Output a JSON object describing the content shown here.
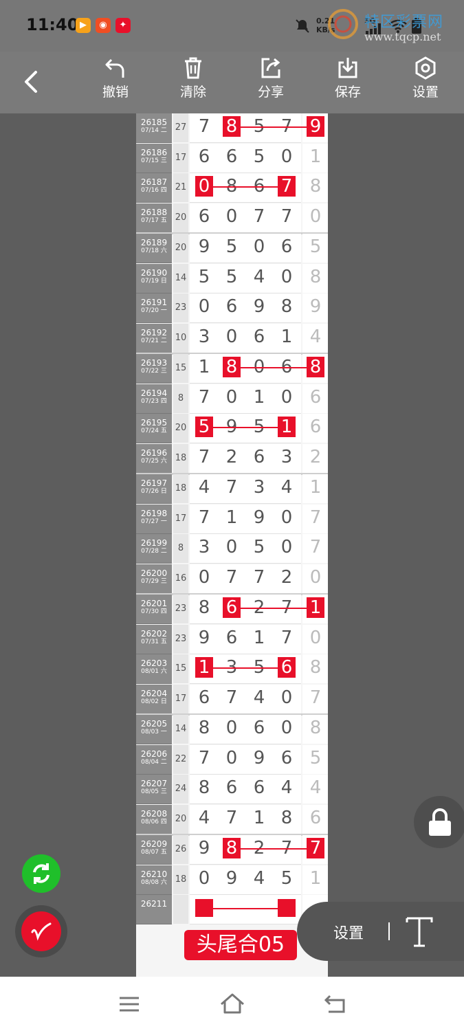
{
  "status": {
    "time": "11:40",
    "net_speed_top": "0.21",
    "net_speed_bottom": "KB/s",
    "signal_label": "5G",
    "watermark_cn": "特区彩票网",
    "watermark_url": "www.tqcp.net"
  },
  "toolbar": {
    "undo": "撤销",
    "clear": "清除",
    "share": "分享",
    "save": "保存",
    "settings": "设置"
  },
  "rows": [
    {
      "no": "26185",
      "date": "07/14 二",
      "sum": "27",
      "d": [
        "7",
        "8",
        "5",
        "7"
      ],
      "tail": "9"
    },
    {
      "no": "26186",
      "date": "07/15 三",
      "sum": "17",
      "d": [
        "6",
        "6",
        "5",
        "0"
      ],
      "tail": "1"
    },
    {
      "no": "26187",
      "date": "07/16 四",
      "sum": "21",
      "d": [
        "0",
        "8",
        "6",
        "7"
      ],
      "tail": "8"
    },
    {
      "no": "26188",
      "date": "07/17 五",
      "sum": "20",
      "d": [
        "6",
        "0",
        "7",
        "7"
      ],
      "tail": "0"
    },
    {
      "no": "26189",
      "date": "07/18 六",
      "sum": "20",
      "d": [
        "9",
        "5",
        "0",
        "6"
      ],
      "tail": "5"
    },
    {
      "no": "26190",
      "date": "07/19 日",
      "sum": "14",
      "d": [
        "5",
        "5",
        "4",
        "0"
      ],
      "tail": "8"
    },
    {
      "no": "26191",
      "date": "07/20 一",
      "sum": "23",
      "d": [
        "0",
        "6",
        "9",
        "8"
      ],
      "tail": "9"
    },
    {
      "no": "26192",
      "date": "07/21 二",
      "sum": "10",
      "d": [
        "3",
        "0",
        "6",
        "1"
      ],
      "tail": "4"
    },
    {
      "no": "26193",
      "date": "07/22 三",
      "sum": "15",
      "d": [
        "1",
        "8",
        "0",
        "6"
      ],
      "tail": "8"
    },
    {
      "no": "26194",
      "date": "07/23 四",
      "sum": "8",
      "d": [
        "7",
        "0",
        "1",
        "0"
      ],
      "tail": "6"
    },
    {
      "no": "26195",
      "date": "07/24 五",
      "sum": "20",
      "d": [
        "5",
        "9",
        "5",
        "1"
      ],
      "tail": "6"
    },
    {
      "no": "26196",
      "date": "07/25 六",
      "sum": "18",
      "d": [
        "7",
        "2",
        "6",
        "3"
      ],
      "tail": "2"
    },
    {
      "no": "26197",
      "date": "07/26 日",
      "sum": "18",
      "d": [
        "4",
        "7",
        "3",
        "4"
      ],
      "tail": "1"
    },
    {
      "no": "26198",
      "date": "07/27 一",
      "sum": "17",
      "d": [
        "7",
        "1",
        "9",
        "0"
      ],
      "tail": "7"
    },
    {
      "no": "26199",
      "date": "07/28 二",
      "sum": "8",
      "d": [
        "3",
        "0",
        "5",
        "0"
      ],
      "tail": "7"
    },
    {
      "no": "26200",
      "date": "07/29 三",
      "sum": "16",
      "d": [
        "0",
        "7",
        "7",
        "2"
      ],
      "tail": "0"
    },
    {
      "no": "26201",
      "date": "07/30 四",
      "sum": "23",
      "d": [
        "8",
        "6",
        "2",
        "7"
      ],
      "tail": "1"
    },
    {
      "no": "26202",
      "date": "07/31 五",
      "sum": "23",
      "d": [
        "9",
        "6",
        "1",
        "7"
      ],
      "tail": "0"
    },
    {
      "no": "26203",
      "date": "08/01 六",
      "sum": "15",
      "d": [
        "1",
        "3",
        "5",
        "6"
      ],
      "tail": "8"
    },
    {
      "no": "26204",
      "date": "08/02 日",
      "sum": "17",
      "d": [
        "6",
        "7",
        "4",
        "0"
      ],
      "tail": "7"
    },
    {
      "no": "26205",
      "date": "08/03 一",
      "sum": "14",
      "d": [
        "8",
        "0",
        "6",
        "0"
      ],
      "tail": "8"
    },
    {
      "no": "26206",
      "date": "08/04 二",
      "sum": "22",
      "d": [
        "7",
        "0",
        "9",
        "6"
      ],
      "tail": "5"
    },
    {
      "no": "26207",
      "date": "08/05 三",
      "sum": "24",
      "d": [
        "8",
        "6",
        "6",
        "4"
      ],
      "tail": "4"
    },
    {
      "no": "26208",
      "date": "08/06 四",
      "sum": "20",
      "d": [
        "4",
        "7",
        "1",
        "8"
      ],
      "tail": "6"
    },
    {
      "no": "26209",
      "date": "08/07 五",
      "sum": "26",
      "d": [
        "9",
        "8",
        "2",
        "7"
      ],
      "tail": "7"
    },
    {
      "no": "26210",
      "date": "08/08 六",
      "sum": "18",
      "d": [
        "0",
        "9",
        "4",
        "5"
      ],
      "tail": "1"
    },
    {
      "no": "26211",
      "date": "",
      "sum": "",
      "d": [
        "",
        "",
        "",
        ""
      ],
      "tail": ""
    }
  ],
  "highlights": [
    {
      "row": 0,
      "digits": [
        1
      ],
      "tail": true,
      "line_from": 1,
      "line_to": "tail"
    },
    {
      "row": 2,
      "digits": [
        0,
        3
      ],
      "tail": false,
      "line_from": 0,
      "line_to": 3
    },
    {
      "row": 8,
      "digits": [
        1
      ],
      "tail": true,
      "line_from": 1,
      "line_to": "tail"
    },
    {
      "row": 10,
      "digits": [
        0,
        3
      ],
      "tail": false,
      "line_from": 0,
      "line_to": 3
    },
    {
      "row": 16,
      "digits": [
        1
      ],
      "tail": true,
      "line_from": 1,
      "line_to": "tail"
    },
    {
      "row": 18,
      "digits": [
        0,
        3
      ],
      "tail": false,
      "line_from": 0,
      "line_to": 3
    },
    {
      "row": 24,
      "digits": [
        1
      ],
      "tail": true,
      "line_from": 1,
      "line_to": "tail"
    },
    {
      "row": 26,
      "digits": [
        0,
        3
      ],
      "tail": false,
      "line_from": 0,
      "line_to": 3
    }
  ],
  "label_red": "头尾合05",
  "pill": {
    "settings": "设置"
  },
  "colors": {
    "accent_red": "#e8102a",
    "green_button": "#1fbf2a"
  }
}
